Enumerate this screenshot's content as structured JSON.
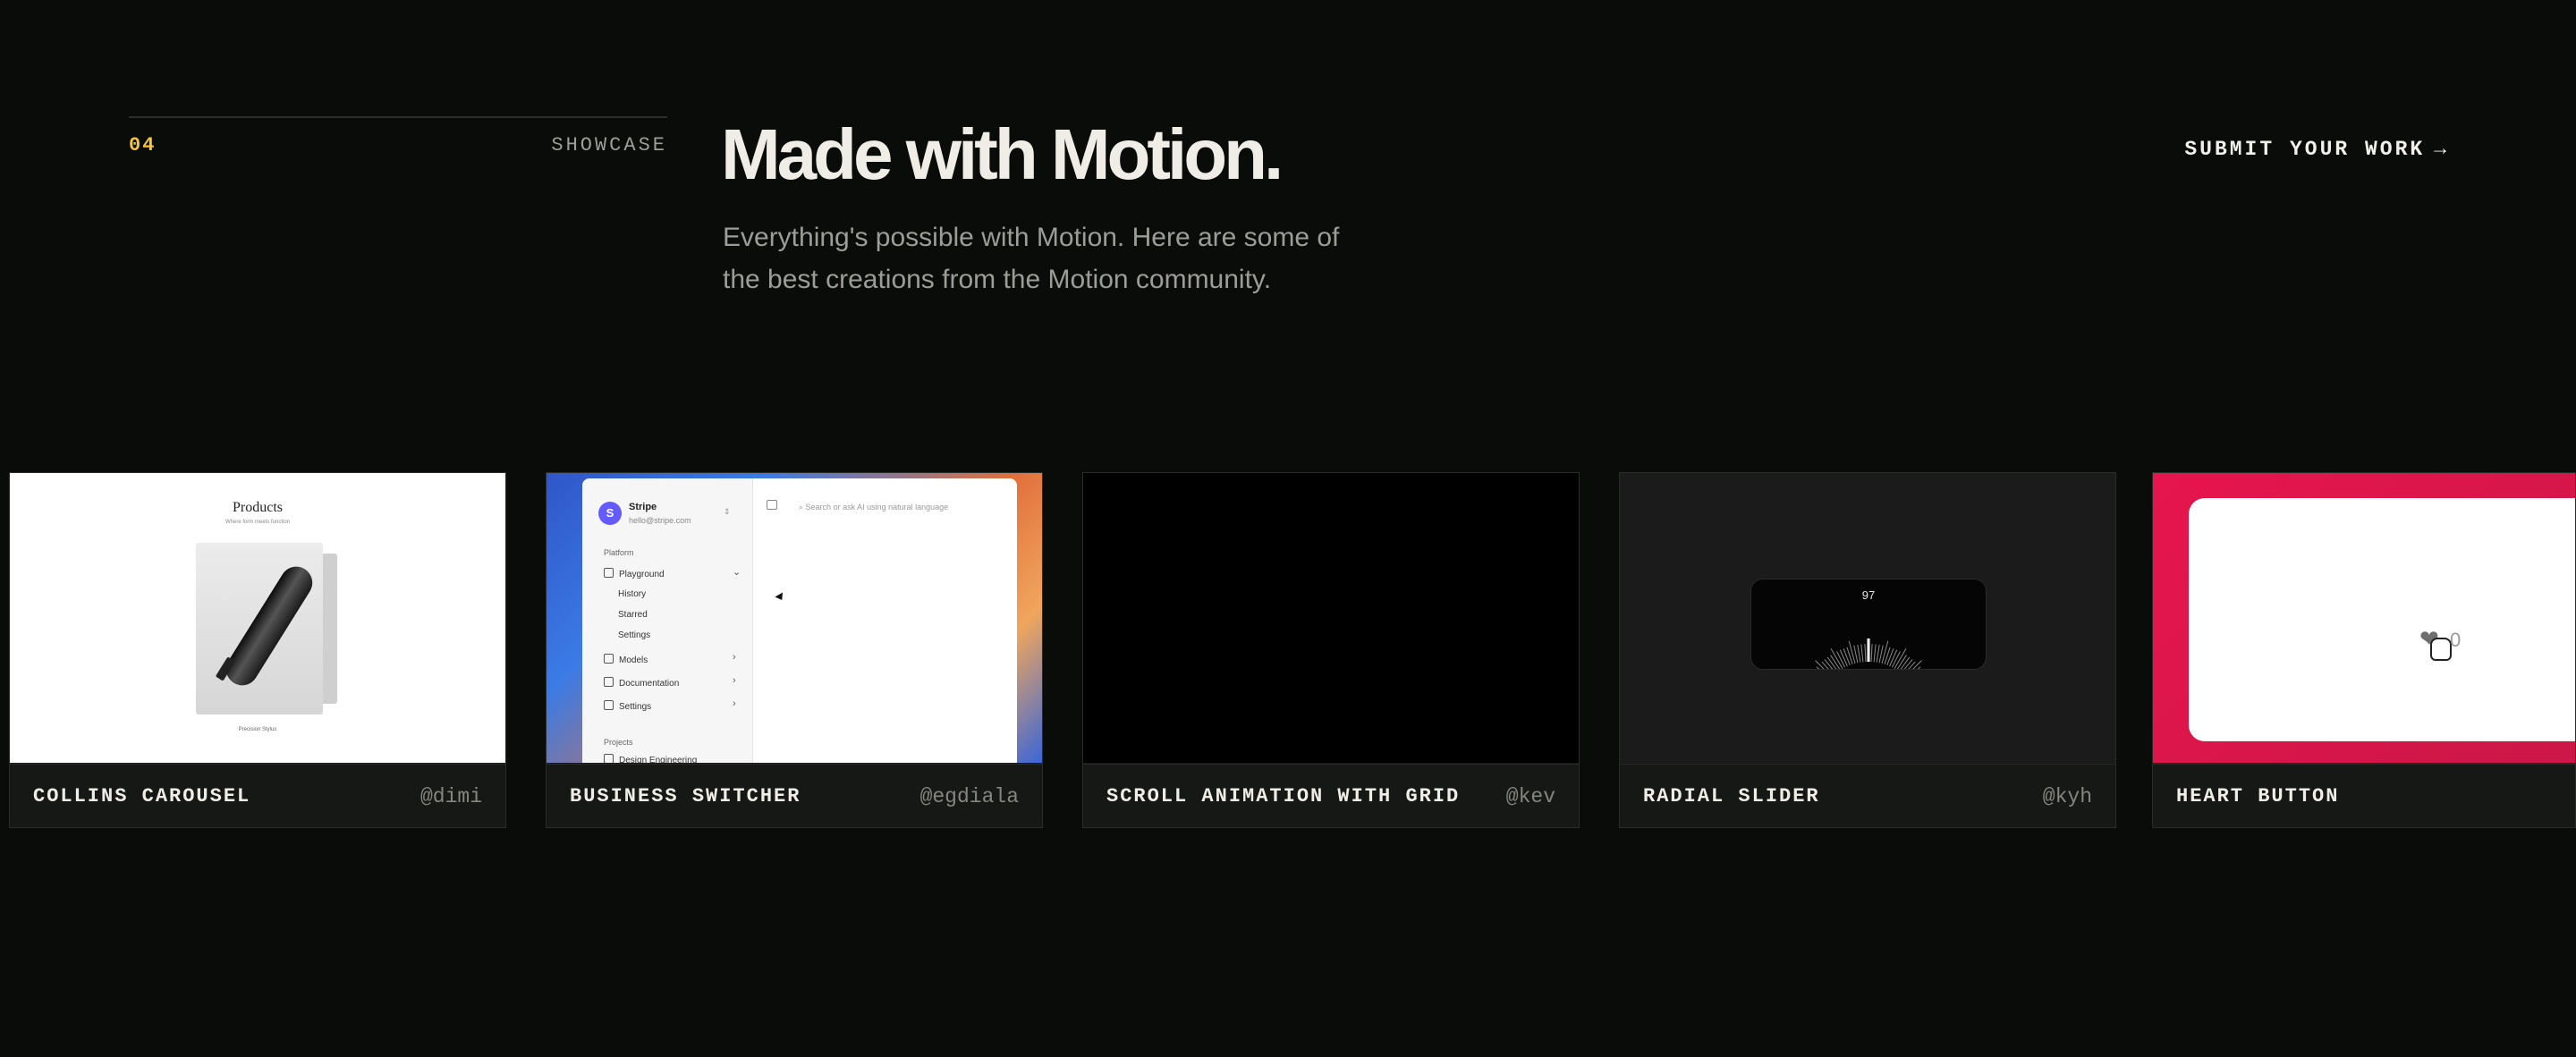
{
  "section": {
    "number": "04",
    "label": "SHOWCASE",
    "title": "Made with Motion.",
    "description": "Everything's possible with Motion. Here are some of the best creations from the Motion community.",
    "submit_label": "SUBMIT YOUR WORK",
    "submit_icon": "arrow-right-icon"
  },
  "cards": [
    {
      "title": "COLLINS CAROUSEL",
      "author": "@dimi",
      "preview": {
        "heading": "Products",
        "subheading": "Where form meets function",
        "caption": "Precision Stylus"
      }
    },
    {
      "title": "BUSINESS SWITCHER",
      "author": "@egdiala",
      "preview": {
        "brand_initial": "S",
        "brand_name": "Stripe",
        "brand_email": "hello@stripe.com",
        "switch_icon": "⇕",
        "search_placeholder": "Search or ask AI using natural language",
        "group_platform": "Platform",
        "items": [
          "Playground",
          "History",
          "Starred",
          "Settings",
          "Models",
          "Documentation",
          "Settings"
        ],
        "group_projects": "Projects",
        "project_item": "Design Engineering"
      }
    },
    {
      "title": "SCROLL ANIMATION WITH GRID",
      "author": "@kev"
    },
    {
      "title": "RADIAL SLIDER",
      "author": "@kyh",
      "preview": {
        "value": "97"
      }
    },
    {
      "title": "HEART BUTTON",
      "author": "",
      "preview": {
        "count": "0"
      }
    }
  ],
  "colors": {
    "background": "#0a0c0a",
    "accent": "#f4c542",
    "card": "#161816",
    "heart_bg": "#e6154d"
  }
}
